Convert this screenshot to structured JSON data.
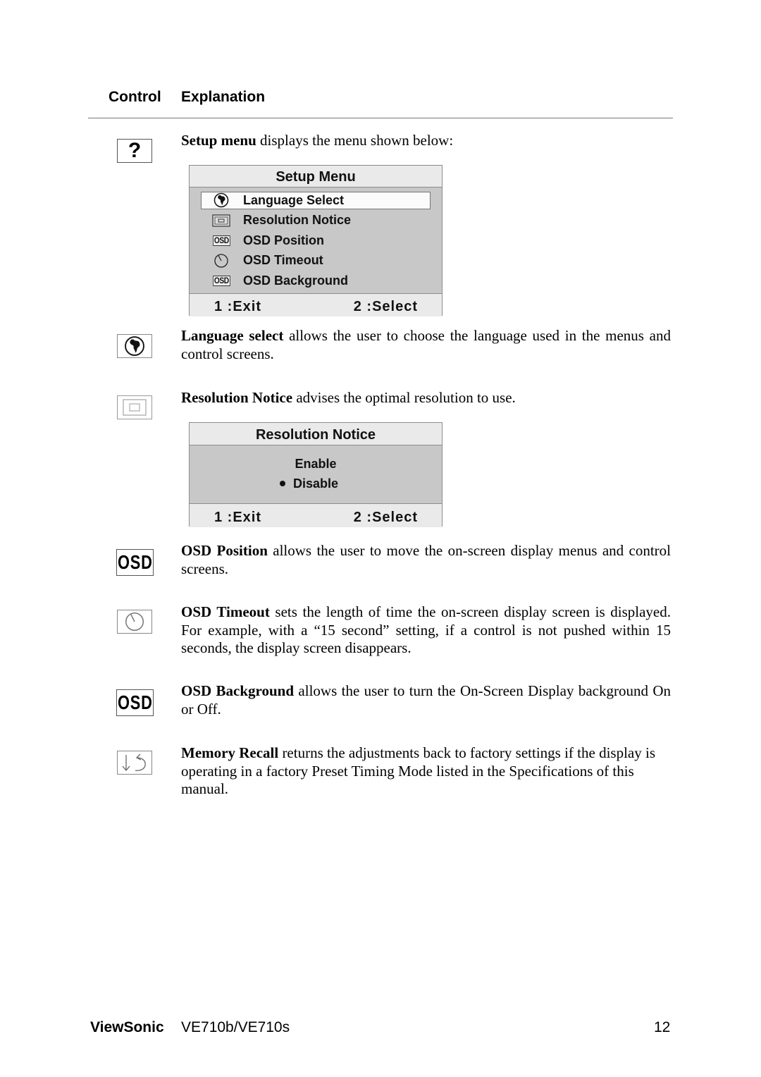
{
  "header": {
    "control_label": "Control",
    "explanation_label": "Explanation"
  },
  "setup": {
    "icon": "question-mark-icon",
    "icon_glyph": "?",
    "bold": "Setup menu",
    "text": " displays the menu shown below:"
  },
  "setup_menu": {
    "title": "Setup Menu",
    "items": [
      {
        "label": "Language Select",
        "icon": "globe-icon",
        "selected": true
      },
      {
        "label": "Resolution Notice",
        "icon": "resolution-icon",
        "selected": false
      },
      {
        "label": "OSD Position",
        "icon": "osd-icon",
        "icon_text": "OSD",
        "selected": false
      },
      {
        "label": "OSD Timeout",
        "icon": "clock-icon",
        "selected": false
      },
      {
        "label": "OSD Background",
        "icon": "osd-icon",
        "icon_text": "OSD",
        "selected": false
      }
    ],
    "footer_left": "1 :Exit",
    "footer_right": "2 :Select"
  },
  "language": {
    "icon": "globe-icon",
    "bold": "Language select",
    "text": " allows the user to choose the language used in the menus and control screens."
  },
  "resolution": {
    "icon": "resolution-icon",
    "bold": "Resolution Notice",
    "text": " advises the optimal resolution to use."
  },
  "resolution_menu": {
    "title": "Resolution Notice",
    "options": [
      {
        "label": "Enable",
        "selected": false
      },
      {
        "label": "Disable",
        "selected": true
      }
    ],
    "footer_left": "1 :Exit",
    "footer_right": "2 :Select"
  },
  "osd_position": {
    "icon": "osd-icon",
    "icon_text": "OSD",
    "bold": "OSD Position",
    "text": " allows the user to move the on-screen display menus and control screens."
  },
  "osd_timeout": {
    "icon": "clock-icon",
    "bold": "OSD Timeout",
    "text": " sets the length of time the on-screen display screen is displayed. For example, with a “15 second” setting, if a control is not pushed within 15 seconds, the display screen disappears."
  },
  "osd_background": {
    "icon": "osd-icon",
    "icon_text": "OSD",
    "bold": "OSD Background",
    "text": " allows the user to turn the On-Screen Display background On or Off."
  },
  "memory_recall": {
    "icon": "memory-recall-icon",
    "bold": "Memory Recall",
    "text": " returns the adjustments back to factory settings if the display is operating in a factory Preset Timing Mode listed in the Specifications of this manual."
  },
  "footer": {
    "brand": "ViewSonic",
    "model": "VE710b/VE710s",
    "page_number": "12"
  }
}
